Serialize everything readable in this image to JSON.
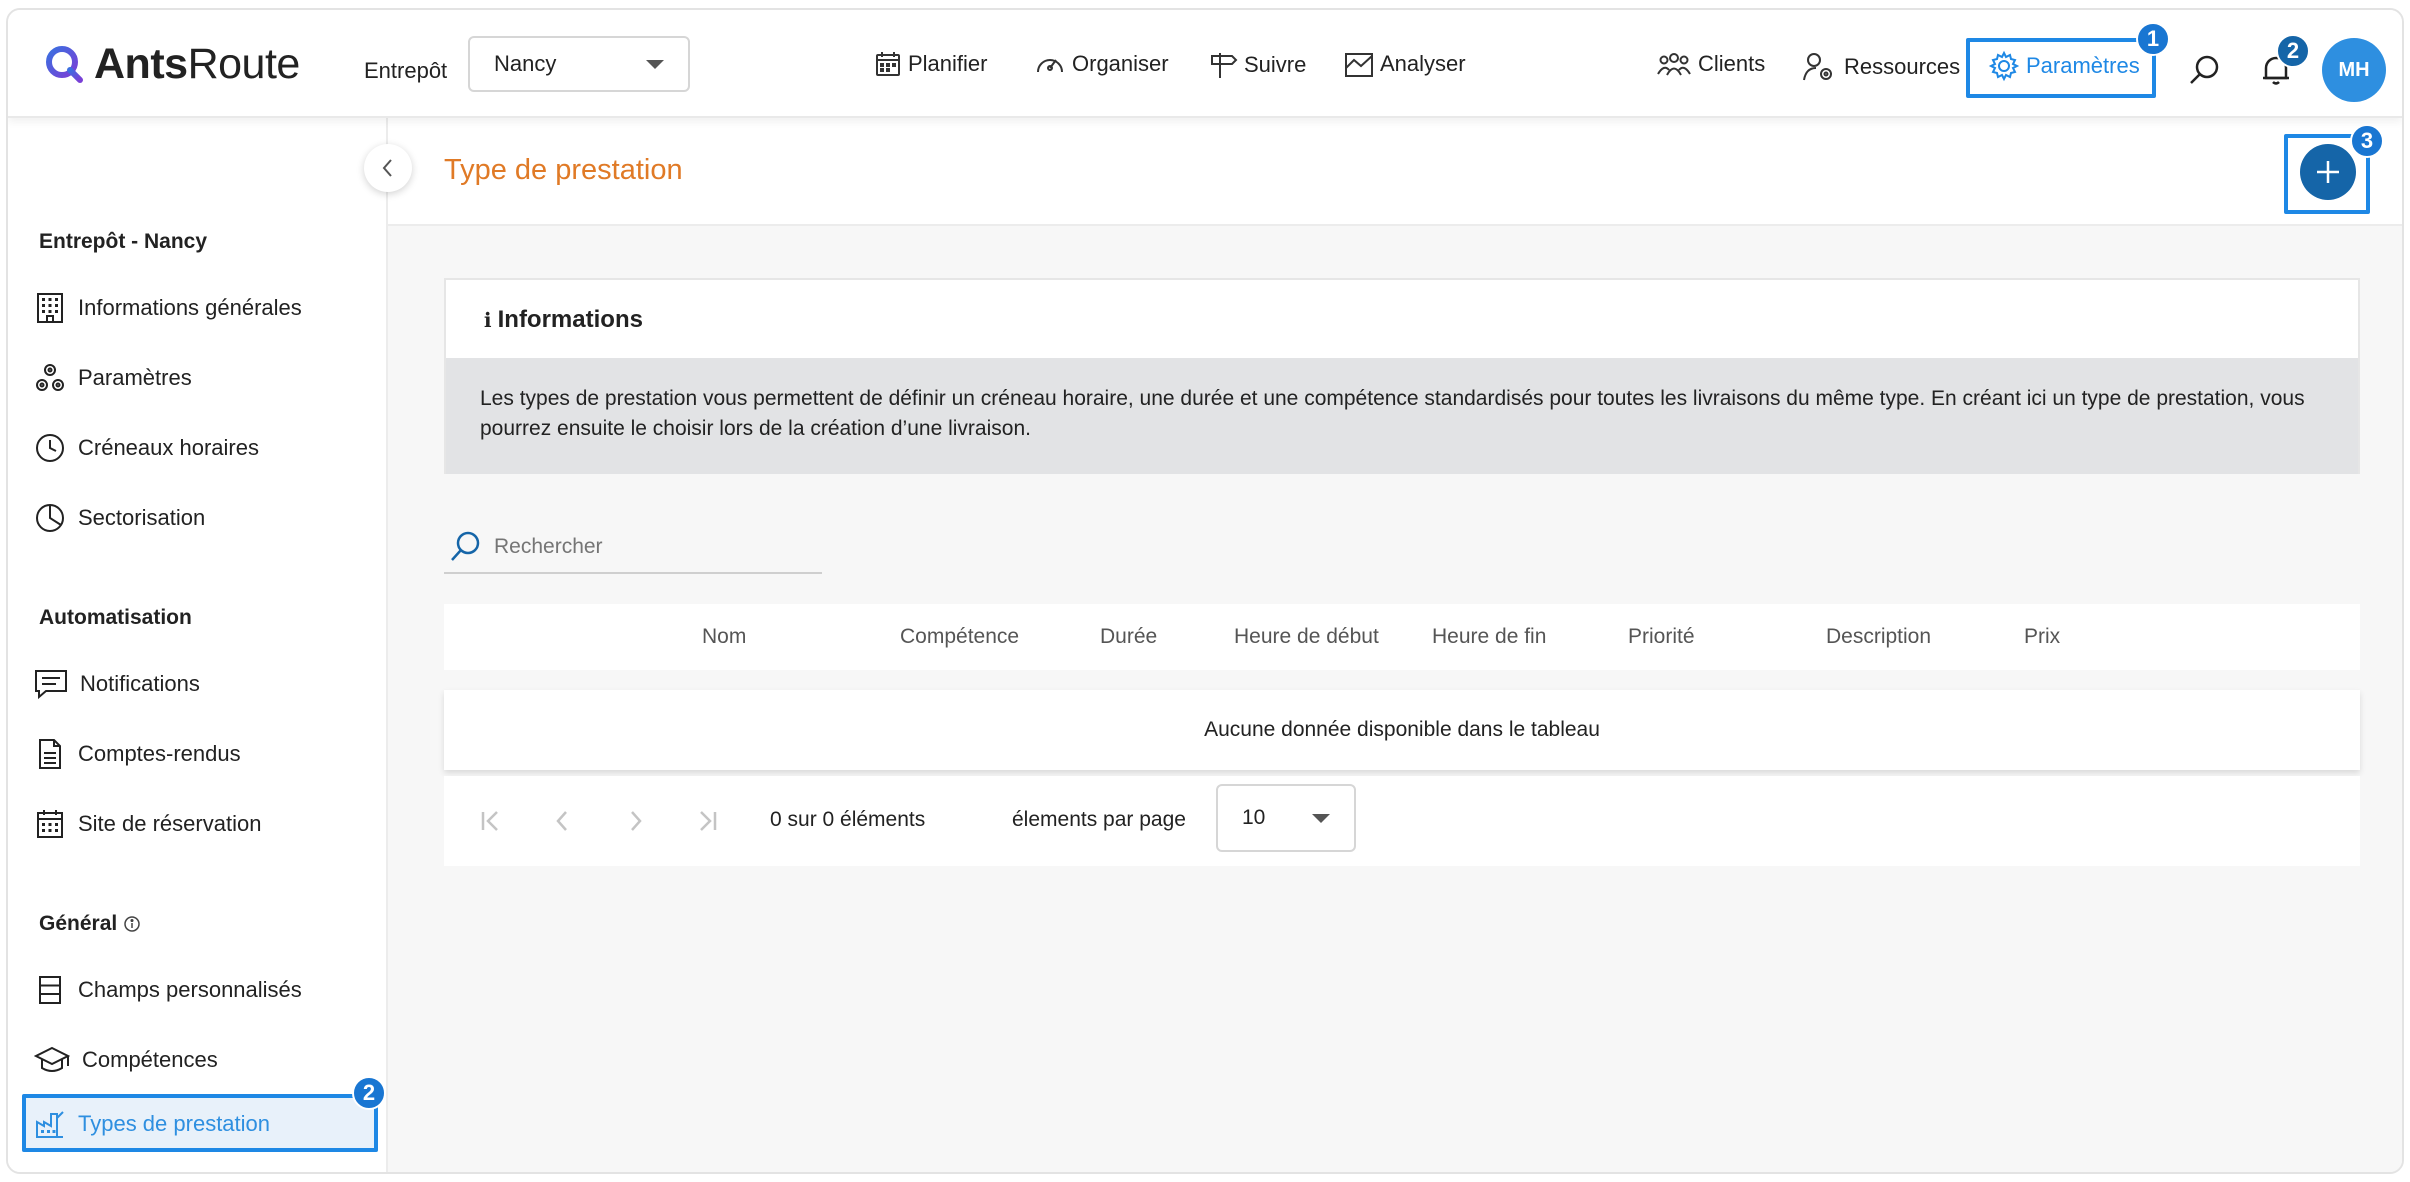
{
  "app": {
    "brand_bold": "Ants",
    "brand_rest": "Route"
  },
  "header": {
    "warehouse_label": "Entrepôt",
    "warehouse_value": "Nancy",
    "nav": [
      {
        "label": "Planifier",
        "icon": "calendar-icon"
      },
      {
        "label": "Organiser",
        "icon": "gauge-icon"
      },
      {
        "label": "Suivre",
        "icon": "signpost-icon"
      },
      {
        "label": "Analyser",
        "icon": "chart-icon"
      }
    ],
    "right_nav": [
      {
        "label": "Clients",
        "icon": "people-icon"
      },
      {
        "label": "Ressources",
        "icon": "user-gear-icon"
      },
      {
        "label": "Paramètres",
        "icon": "gear-icon"
      }
    ],
    "avatar": "MH",
    "steps": {
      "settings": "1",
      "notifications": "2",
      "add": "3",
      "sidebar": "2"
    }
  },
  "sidebar": {
    "section_warehouse": "Entrepôt - Nancy",
    "warehouse_items": [
      "Informations générales",
      "Paramètres",
      "Créneaux horaires",
      "Sectorisation"
    ],
    "section_automation": "Automatisation",
    "automation_items": [
      "Notifications",
      "Comptes-rendus",
      "Site de réservation"
    ],
    "section_general": "Général",
    "general_items": [
      "Champs personnalisés",
      "Compétences",
      "Types de prestation"
    ]
  },
  "main": {
    "title": "Type de prestation",
    "info_title": "Informations",
    "info_text": "Les types de prestation vous permettent de définir un créneau horaire, une durée et une compétence standardisés pour toutes les livraisons du même type. En créant ici un type de prestation, vous pourrez ensuite le choisir lors de la création d’une livraison.",
    "search_placeholder": "Rechercher",
    "columns": [
      "Nom",
      "Compétence",
      "Durée",
      "Heure de début",
      "Heure de fin",
      "Priorité",
      "Description",
      "Prix"
    ],
    "empty_text": "Aucune donnée disponible dans le tableau",
    "pager_count": "0 sur 0 éléments",
    "per_page_label": "élements par page",
    "per_page_value": "10"
  },
  "colors": {
    "accent": "#1e88e5",
    "title_orange": "#e07a26",
    "primary_dark": "#1565a8"
  }
}
